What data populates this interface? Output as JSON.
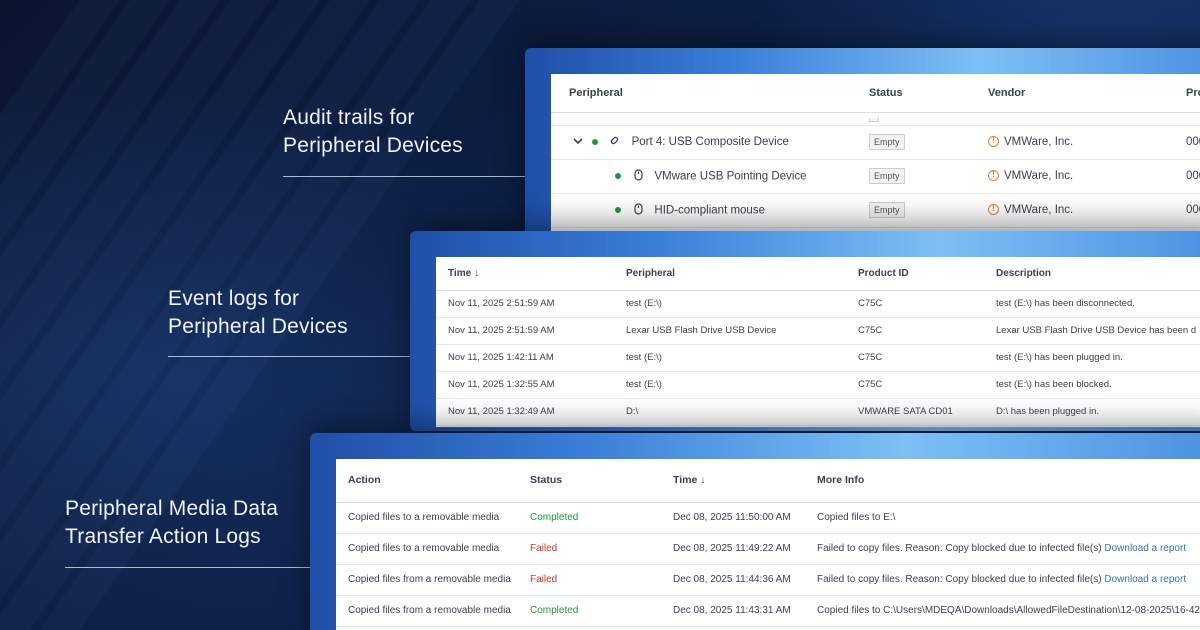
{
  "captions": {
    "audit": [
      "Audit trails for",
      "Peripheral Devices"
    ],
    "event": [
      "Event logs for",
      "Peripheral Devices"
    ],
    "media": [
      "Peripheral Media Data",
      "Transfer Action Logs"
    ]
  },
  "audit_table": {
    "headers": {
      "peripheral": "Peripheral",
      "status": "Status",
      "vendor": "Vendor",
      "product": "Pro"
    },
    "rows": [
      {
        "name": "Port 4: USB Composite Device",
        "status": "Empty",
        "vendor": "VMWare, Inc.",
        "product": "000"
      },
      {
        "name": "VMware USB Pointing Device",
        "status": "Empty",
        "vendor": "VMWare, Inc.",
        "product": "000"
      },
      {
        "name": "HID-compliant mouse",
        "status": "Empty",
        "vendor": "VMWare, Inc.",
        "product": "000"
      }
    ]
  },
  "event_table": {
    "headers": {
      "time": "Time",
      "peripheral": "Peripheral",
      "product_id": "Product ID",
      "description": "Description"
    },
    "rows": [
      {
        "time": "Nov 11, 2025 2:51:59 AM",
        "peripheral": "test (E:\\)",
        "product_id": "C75C",
        "description": "test (E:\\) has been disconnected."
      },
      {
        "time": "Nov 11, 2025 2:51:59 AM",
        "peripheral": "Lexar USB Flash Drive USB Device",
        "product_id": "C75C",
        "description": "Lexar USB Flash Drive USB Device has been d"
      },
      {
        "time": "Nov 11, 2025 1:42:11 AM",
        "peripheral": "test (E:\\)",
        "product_id": "C75C",
        "description": "test (E:\\) has been plugged in."
      },
      {
        "time": "Nov 11, 2025 1:32:55 AM",
        "peripheral": "test (E:\\)",
        "product_id": "C75C",
        "description": "test (E:\\) has been blocked."
      },
      {
        "time": "Nov 11, 2025 1:32:49 AM",
        "peripheral": "D:\\",
        "product_id": "VMWARE SATA CD01",
        "description": "D:\\ has been plugged in."
      }
    ]
  },
  "media_table": {
    "headers": {
      "action": "Action",
      "status": "Status",
      "time": "Time",
      "info": "More Info"
    },
    "rows": [
      {
        "action": "Copied files to a removable media",
        "status": "Completed",
        "status_kind": "ok",
        "time": "Dec 08, 2025 11:50:00 AM",
        "info": "Copied files to E:\\",
        "link": ""
      },
      {
        "action": "Copied files to a removable media",
        "status": "Failed",
        "status_kind": "fail",
        "time": "Dec 08, 2025 11:49:22 AM",
        "info": "Failed to copy files. Reason: Copy blocked due to infected file(s)",
        "link": "Download a report"
      },
      {
        "action": "Copied files from a removable media",
        "status": "Failed",
        "status_kind": "fail",
        "time": "Dec 08, 2025 11:44:36 AM",
        "info": "Failed to copy files. Reason: Copy blocked due to infected file(s)",
        "link": "Download a report"
      },
      {
        "action": "Copied files from a removable media",
        "status": "Completed",
        "status_kind": "ok",
        "time": "Dec 08, 2025 11:43:31 AM",
        "info": "Copied files to C:\\Users\\MDEQA\\Downloads\\AllowedFileDestination\\12-08-2025\\16-42",
        "link": ""
      }
    ]
  },
  "colors": {
    "completed": "#1f9a3b",
    "failed": "#d6322c",
    "link": "#2f6fd6",
    "warning": "#e8802a"
  }
}
